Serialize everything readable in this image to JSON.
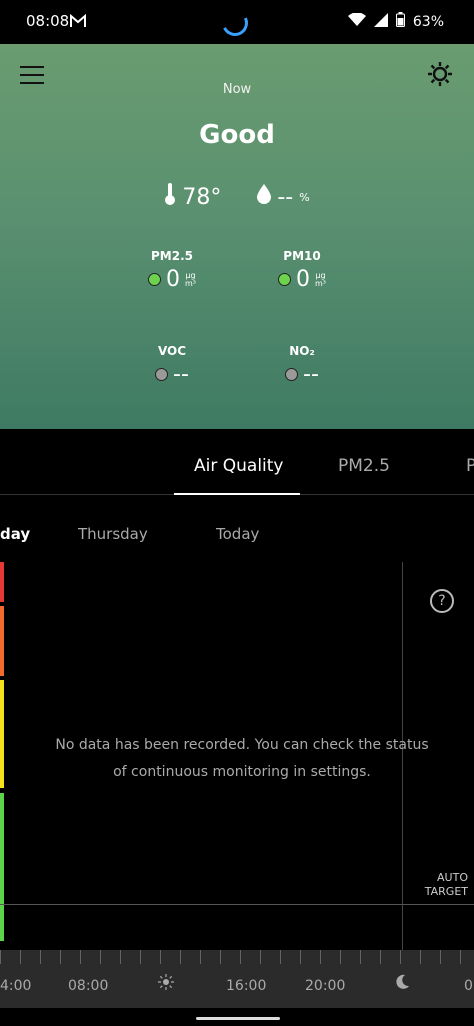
{
  "status_bar": {
    "time": "08:08",
    "battery": "63%"
  },
  "hero": {
    "label": "Now",
    "status": "Good",
    "temperature": "78°",
    "humidity": "--",
    "humidity_unit": "%",
    "metrics": [
      {
        "name": "PM2.5",
        "value": "0",
        "unit_top": "µg",
        "unit_bottom": "m³",
        "color": "#6dd34f"
      },
      {
        "name": "PM10",
        "value": "0",
        "unit_top": "µg",
        "unit_bottom": "m³",
        "color": "#6dd34f"
      },
      {
        "name": "VOC",
        "value": "--",
        "color": "#9a9a9a"
      },
      {
        "name": "NO₂",
        "value": "--",
        "color": "#9a9a9a"
      }
    ]
  },
  "tabs": [
    "Air Quality",
    "PM2.5",
    "P"
  ],
  "days": [
    "day",
    "Thursday",
    "Today"
  ],
  "chart": {
    "message_line1": "No data has been recorded. You can check the status",
    "message_line2": "of continuous monitoring in settings.",
    "auto_line1": "AUTO",
    "auto_line2": "TARGET",
    "help": "?",
    "band_colors": [
      "#e53935",
      "#f26b2d",
      "#f5e11c",
      "#5dd34b"
    ]
  },
  "timeline": {
    "labels": [
      "4:00",
      "08:00",
      "16:00",
      "20:00",
      "0"
    ]
  }
}
